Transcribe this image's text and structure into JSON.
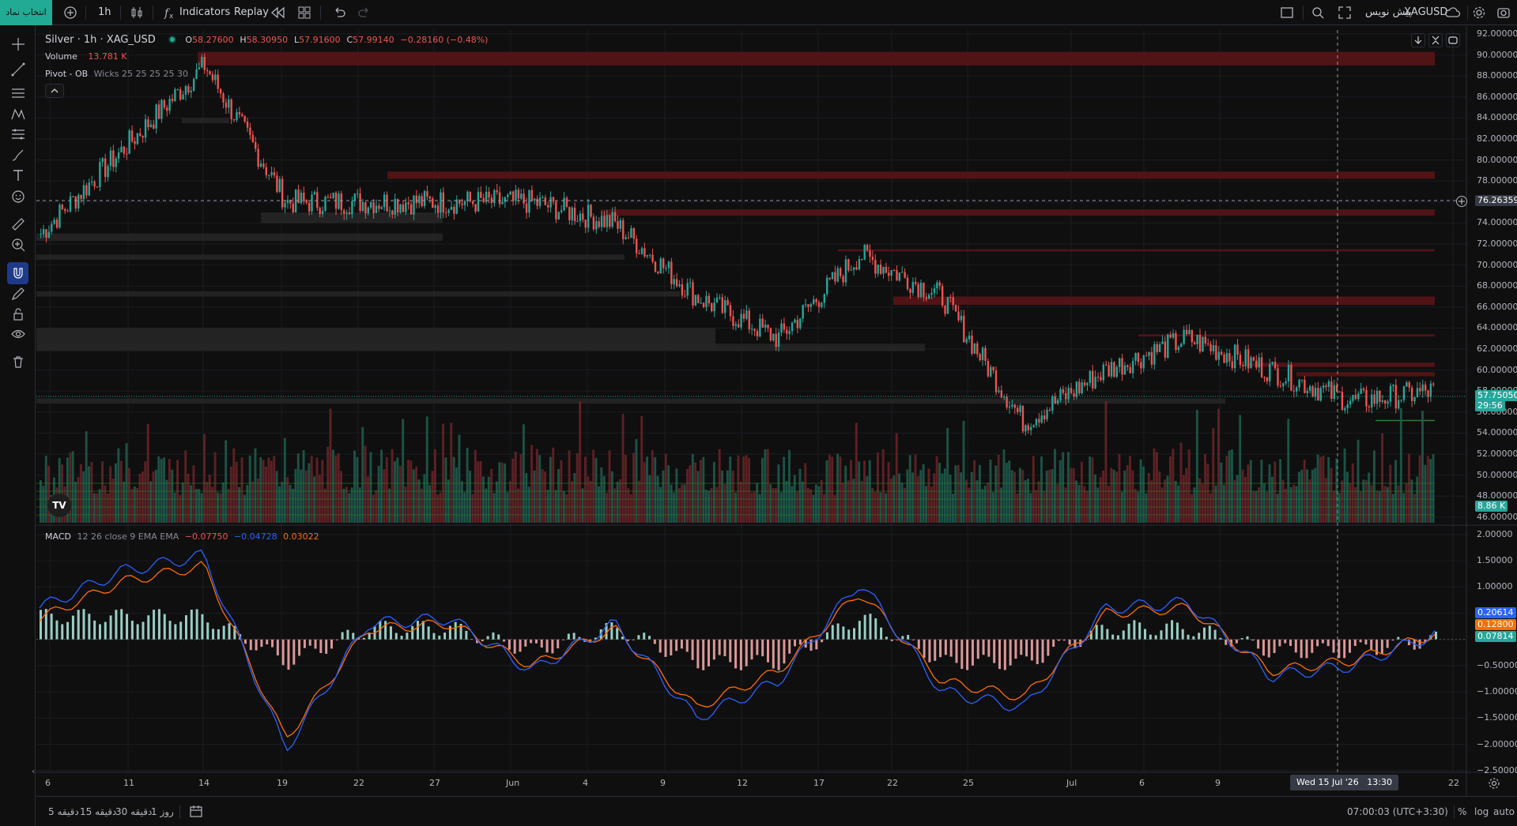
{
  "topbar": {
    "symbol_select": "انتخاب نماد",
    "interval": "1h",
    "indicators": "Indicators",
    "replay": "Replay",
    "symbol_name": "XAGUSD",
    "publish": "پیش نویس"
  },
  "legend": {
    "title": "Silver · 1h · XAG_USD",
    "open_label": "O",
    "open": "58.27600",
    "high_label": "H",
    "high": "58.30950",
    "low_label": "L",
    "low": "57.91600",
    "close_label": "C",
    "close": "57.99140",
    "change": "−0.28160 (−0.48%)",
    "volume_label": "Volume",
    "volume_value": "13.781 K",
    "pivot_label": "Pivot - OB",
    "pivot_params": "Wicks 25 25 25 25 30",
    "macd_label": "MACD",
    "macd_params": "12 26 close 9 EMA EMA",
    "macd_v1": "−0.07750",
    "macd_v2": "−0.04728",
    "macd_v3": "0.03022"
  },
  "price_axis": [
    "92.00000",
    "90.00000",
    "88.00000",
    "86.00000",
    "84.00000",
    "82.00000",
    "80.00000",
    "78.00000",
    "76.00000",
    "74.00000",
    "72.00000",
    "70.00000",
    "68.00000",
    "66.00000",
    "64.00000",
    "62.00000",
    "60.00000",
    "58.00000",
    "56.00000",
    "54.00000",
    "52.00000",
    "50.00000",
    "48.00000",
    "46.00000"
  ],
  "macd_axis": [
    "2.00000",
    "1.50000",
    "1.00000",
    "0.50000",
    "0.00000",
    "−0.50000",
    "−1.00000",
    "−1.50000",
    "−2.00000",
    "−2.50000"
  ],
  "price_labels": {
    "crosshair": "76.26359",
    "last_price": "57.75050",
    "countdown": "29:56",
    "volume_last": "8.86 K",
    "macd_a": "0.20614",
    "macd_b": "0.12800",
    "macd_c": "0.07814"
  },
  "time_axis": [
    "6",
    "11",
    "14",
    "19",
    "22",
    "27",
    "Jun",
    "4",
    "9",
    "12",
    "17",
    "22",
    "25",
    "Jul",
    "6",
    "9",
    "22"
  ],
  "crosshair_time": "Wed 15 Jul '26   13:30",
  "bottombar": {
    "ranges": [
      "5 دقیقه",
      "15 دقیقه",
      "30 دقیقه",
      "1 روز"
    ],
    "clock": "07:00:03 (UTC+3:30)",
    "percent": "%",
    "log": "log",
    "auto": "auto"
  },
  "colors": {
    "up": "#26a69a",
    "down": "#ef5350",
    "macd": "#2962ff",
    "signal": "#ff6d00",
    "accent": "#22ab94"
  },
  "chart_data": [
    {
      "type": "line",
      "title": "Silver · 1h · XAG_USD",
      "x": [
        "6",
        "11",
        "14",
        "19",
        "22",
        "27",
        "Jun",
        "4",
        "9",
        "12",
        "17",
        "22",
        "25",
        "Jul",
        "6",
        "9",
        "15",
        "22"
      ],
      "series": [
        {
          "values": [
            73,
            81,
            89,
            76,
            76,
            76,
            76,
            74,
            67,
            63,
            71,
            67,
            55,
            60,
            63,
            60,
            57,
            58
          ]
        }
      ],
      "ylim": [
        46,
        92
      ]
    },
    {
      "type": "line",
      "title": "MACD 12 26 close 9 EMA EMA",
      "x": [
        "6",
        "11",
        "14",
        "19",
        "22",
        "27",
        "Jun",
        "4",
        "9",
        "12",
        "17",
        "22",
        "25",
        "Jul",
        "6",
        "9",
        "15",
        "22"
      ],
      "series": [
        {
          "values": [
            0.6,
            1.3,
            1.6,
            -2.1,
            0.3,
            0.4,
            -0.6,
            0.3,
            -1.5,
            -0.8,
            1.1,
            -1.0,
            -1.3,
            0.6,
            0.7,
            -0.7,
            -0.5,
            0.1
          ]
        },
        {
          "values": [
            0.4,
            1.1,
            1.4,
            -1.9,
            0.2,
            0.3,
            -0.5,
            0.2,
            -1.3,
            -0.6,
            0.9,
            -0.8,
            -1.1,
            0.5,
            0.6,
            -0.6,
            -0.4,
            0.1
          ]
        }
      ],
      "ylim": [
        -2.5,
        2.0
      ]
    }
  ]
}
